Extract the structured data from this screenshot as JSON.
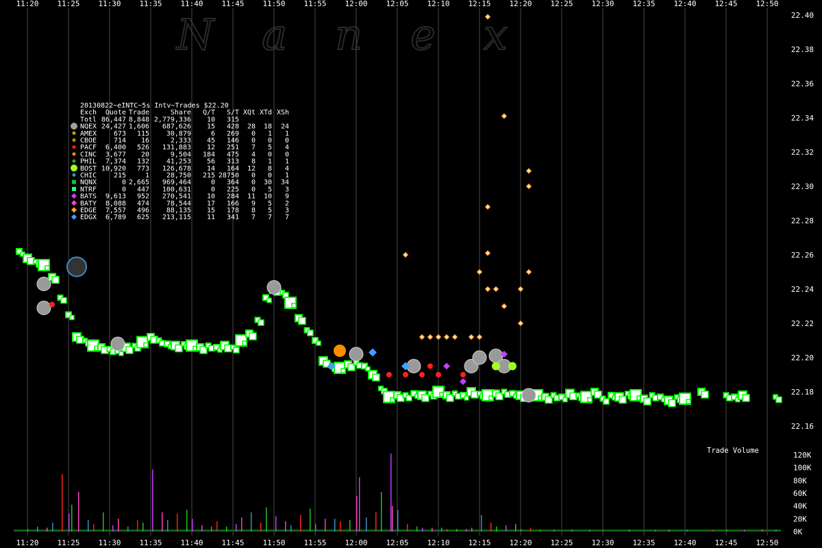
{
  "chart_data": {
    "type": "scatter",
    "watermark": "Nanex",
    "x_ticks": [
      "11:20",
      "11:25",
      "11:30",
      "11:35",
      "11:40",
      "11:45",
      "11:50",
      "11:55",
      "12:00",
      "12:05",
      "12:10",
      "12:15",
      "12:20",
      "12:25",
      "12:30",
      "12:35",
      "12:40",
      "12:45",
      "12:50"
    ],
    "y_ticks": [
      "22.40",
      "22.38",
      "22.36",
      "22.34",
      "22.32",
      "22.30",
      "22.28",
      "22.26",
      "22.24",
      "22.22",
      "22.20",
      "22.18",
      "22.16"
    ],
    "ylim": [
      22.16,
      22.4
    ],
    "volume_label": "Trade Volume",
    "volume_ticks": [
      "120K",
      "100K",
      "80K",
      "60K",
      "40K",
      "20K",
      "0K"
    ],
    "volume_ylim": [
      0,
      120000
    ],
    "table": {
      "title": "20130822~eINTC~5s Intv~Trades $22.20",
      "headers": [
        "Exch",
        "Quote",
        "Trade",
        "Share",
        "Q/T",
        "S/T",
        "XQt",
        "XTd",
        "XSh"
      ],
      "rows": [
        {
          "exch": "Totl",
          "quote": "86,447",
          "trade": "8,848",
          "share": "2,779,336",
          "qt": "10",
          "st": "315",
          "xqt": "",
          "xtd": "",
          "xsh": "",
          "color": "",
          "marker": ""
        },
        {
          "exch": "NQEX",
          "quote": "24,427",
          "trade": "1,606",
          "share": "687,626",
          "qt": "15",
          "st": "428",
          "xqt": "28",
          "xtd": "18",
          "xsh": "24",
          "color": "#a0a0a0",
          "marker": "bigcircle"
        },
        {
          "exch": "AMEX",
          "quote": "673",
          "trade": "115",
          "share": "30,879",
          "qt": "6",
          "st": "269",
          "xqt": "0",
          "xtd": "1",
          "xsh": "1",
          "color": "#c8a000",
          "marker": "circle"
        },
        {
          "exch": "CBOE",
          "quote": "714",
          "trade": "16",
          "share": "2,333",
          "qt": "45",
          "st": "146",
          "xqt": "0",
          "xtd": "0",
          "xsh": "0",
          "color": "#a0a000",
          "marker": "circle"
        },
        {
          "exch": "PACF",
          "quote": "6,400",
          "trade": "526",
          "share": "131,883",
          "qt": "12",
          "st": "251",
          "xqt": "7",
          "xtd": "5",
          "xsh": "4",
          "color": "#ff2020",
          "marker": "circle"
        },
        {
          "exch": "CINC",
          "quote": "3,677",
          "trade": "20",
          "share": "9,504",
          "qt": "184",
          "st": "475",
          "xqt": "4",
          "xtd": "0",
          "xsh": "0",
          "color": "#ff8c00",
          "marker": "circle"
        },
        {
          "exch": "PHIL",
          "quote": "7,374",
          "trade": "132",
          "share": "41,253",
          "qt": "56",
          "st": "313",
          "xqt": "8",
          "xtd": "1",
          "xsh": "1",
          "color": "#20b020",
          "marker": "circle"
        },
        {
          "exch": "BOST",
          "quote": "10,920",
          "trade": "773",
          "share": "126,678",
          "qt": "14",
          "st": "164",
          "xqt": "12",
          "xtd": "8",
          "xsh": "4",
          "color": "#a0ff20",
          "marker": "bigcircle"
        },
        {
          "exch": "CHIC",
          "quote": "215",
          "trade": "1",
          "share": "28,750",
          "qt": "215",
          "st": "28750",
          "xqt": "0",
          "xtd": "0",
          "xsh": "1",
          "color": "#3c8cc8",
          "marker": "circle"
        },
        {
          "exch": "NQNX",
          "quote": "0",
          "trade": "2,665",
          "share": "969,464",
          "qt": "0",
          "st": "364",
          "xqt": "0",
          "xtd": "30",
          "xsh": "34",
          "color": "#20c020",
          "marker": "square"
        },
        {
          "exch": "NTRF",
          "quote": "0",
          "trade": "447",
          "share": "100,631",
          "qt": "0",
          "st": "225",
          "xqt": "0",
          "xtd": "5",
          "xsh": "3",
          "color": "#20ff80",
          "marker": "square"
        },
        {
          "exch": "BATS",
          "quote": "9,613",
          "trade": "952",
          "share": "270,541",
          "qt": "10",
          "st": "284",
          "xqt": "11",
          "xtd": "10",
          "xsh": "9",
          "color": "#c040ff",
          "marker": "diamond"
        },
        {
          "exch": "BATY",
          "quote": "8,088",
          "trade": "474",
          "share": "78,544",
          "qt": "17",
          "st": "166",
          "xqt": "9",
          "xtd": "5",
          "xsh": "2",
          "color": "#ff40c0",
          "marker": "diamond"
        },
        {
          "exch": "EDGE",
          "quote": "7,557",
          "trade": "496",
          "share": "88,135",
          "qt": "15",
          "st": "178",
          "xqt": "8",
          "xtd": "5",
          "xsh": "3",
          "color": "#ffa030",
          "marker": "diamond"
        },
        {
          "exch": "EDGX",
          "quote": "6,789",
          "trade": "625",
          "share": "213,115",
          "qt": "11",
          "st": "341",
          "xqt": "7",
          "xtd": "7",
          "xsh": "7",
          "color": "#40a0ff",
          "marker": "diamond"
        }
      ]
    },
    "trade_series": [
      {
        "exchange": "NQNX",
        "color": "#00ff00",
        "points": [
          [
            "11:19",
            22.262
          ],
          [
            "11:20",
            22.258
          ],
          [
            "11:21",
            22.256
          ],
          [
            "11:22",
            22.254
          ],
          [
            "11:23",
            22.247
          ],
          [
            "11:24",
            22.235
          ],
          [
            "11:25",
            22.225
          ],
          [
            "11:26",
            22.212
          ],
          [
            "11:27",
            22.21
          ],
          [
            "11:28",
            22.207
          ],
          [
            "11:29",
            22.206
          ],
          [
            "11:30",
            22.205
          ],
          [
            "11:31",
            22.204
          ],
          [
            "11:32",
            22.206
          ],
          [
            "11:33",
            22.207
          ],
          [
            "11:34",
            22.209
          ],
          [
            "11:35",
            22.212
          ],
          [
            "11:36",
            22.21
          ],
          [
            "11:37",
            22.208
          ],
          [
            "11:38",
            22.207
          ],
          [
            "11:39",
            22.208
          ],
          [
            "11:40",
            22.207
          ],
          [
            "11:41",
            22.206
          ],
          [
            "11:42",
            22.207
          ],
          [
            "11:43",
            22.206
          ],
          [
            "11:44",
            22.207
          ],
          [
            "11:45",
            22.206
          ],
          [
            "11:46",
            22.21
          ],
          [
            "11:47",
            22.214
          ],
          [
            "11:48",
            22.222
          ],
          [
            "11:49",
            22.235
          ],
          [
            "11:50",
            22.24
          ],
          [
            "11:51",
            22.238
          ],
          [
            "11:52",
            22.232
          ],
          [
            "11:53",
            22.223
          ],
          [
            "11:54",
            22.216
          ],
          [
            "11:55",
            22.21
          ],
          [
            "11:56",
            22.198
          ],
          [
            "11:57",
            22.195
          ],
          [
            "11:58",
            22.194
          ],
          [
            "11:59",
            22.196
          ],
          [
            "12:00",
            22.197
          ],
          [
            "12:01",
            22.195
          ],
          [
            "12:02",
            22.19
          ],
          [
            "12:03",
            22.182
          ],
          [
            "12:04",
            22.177
          ],
          [
            "12:05",
            22.178
          ],
          [
            "12:06",
            22.178
          ],
          [
            "12:07",
            22.179
          ],
          [
            "12:08",
            22.178
          ],
          [
            "12:09",
            22.179
          ],
          [
            "12:10",
            22.18
          ],
          [
            "12:11",
            22.178
          ],
          [
            "12:12",
            22.179
          ],
          [
            "12:13",
            22.178
          ],
          [
            "12:14",
            22.18
          ],
          [
            "12:15",
            22.179
          ],
          [
            "12:16",
            22.178
          ],
          [
            "12:17",
            22.179
          ],
          [
            "12:18",
            22.18
          ],
          [
            "12:19",
            22.179
          ],
          [
            "12:20",
            22.178
          ],
          [
            "12:21",
            22.179
          ],
          [
            "12:22",
            22.178
          ],
          [
            "12:23",
            22.177
          ],
          [
            "12:24",
            22.178
          ],
          [
            "12:25",
            22.177
          ],
          [
            "12:26",
            22.179
          ],
          [
            "12:27",
            22.178
          ],
          [
            "12:28",
            22.177
          ],
          [
            "12:29",
            22.18
          ],
          [
            "12:30",
            22.176
          ],
          [
            "12:31",
            22.178
          ],
          [
            "12:32",
            22.177
          ],
          [
            "12:33",
            22.179
          ],
          [
            "12:34",
            22.178
          ],
          [
            "12:35",
            22.176
          ],
          [
            "12:36",
            22.178
          ],
          [
            "12:37",
            22.177
          ],
          [
            "12:38",
            22.175
          ],
          [
            "12:39",
            22.177
          ],
          [
            "12:40",
            22.176
          ],
          [
            "12:42",
            22.18
          ],
          [
            "12:45",
            22.178
          ],
          [
            "12:46",
            22.177
          ],
          [
            "12:47",
            22.178
          ],
          [
            "12:51",
            22.177
          ]
        ]
      },
      {
        "exchange": "NQEX",
        "color": "#a0a0a0",
        "points": [
          [
            "11:22",
            22.243
          ],
          [
            "11:22",
            22.229
          ],
          [
            "11:31",
            22.208
          ],
          [
            "11:50",
            22.241
          ],
          [
            "12:00",
            22.202
          ],
          [
            "12:07",
            22.195
          ],
          [
            "12:14",
            22.195
          ],
          [
            "12:15",
            22.2
          ],
          [
            "12:17",
            22.201
          ],
          [
            "12:18",
            22.195
          ],
          [
            "12:21",
            22.178
          ]
        ]
      },
      {
        "exchange": "EDGE",
        "color": "#ffa030",
        "points": [
          [
            "12:08",
            22.212
          ],
          [
            "12:09",
            22.212
          ],
          [
            "12:10",
            22.212
          ],
          [
            "12:11",
            22.212
          ],
          [
            "12:12",
            22.212
          ],
          [
            "12:14",
            22.212
          ],
          [
            "12:15",
            22.212
          ],
          [
            "12:06",
            22.26
          ],
          [
            "12:15",
            22.25
          ],
          [
            "12:16",
            22.24
          ],
          [
            "12:17",
            22.24
          ],
          [
            "12:20",
            22.24
          ],
          [
            "12:18",
            22.23
          ],
          [
            "12:20",
            22.22
          ],
          [
            "12:16",
            22.261
          ],
          [
            "12:18",
            22.341
          ],
          [
            "12:16",
            22.288
          ],
          [
            "12:21",
            22.309
          ],
          [
            "12:21",
            22.3
          ],
          [
            "12:21",
            22.25
          ],
          [
            "12:16",
            22.399
          ]
        ]
      },
      {
        "exchange": "BATS",
        "color": "#c040ff",
        "points": [
          [
            "12:18",
            22.202
          ],
          [
            "12:11",
            22.195
          ],
          [
            "12:13",
            22.186
          ]
        ]
      },
      {
        "exchange": "EDGX",
        "color": "#40a0ff",
        "points": [
          [
            "12:06",
            22.195
          ],
          [
            "12:02",
            22.203
          ],
          [
            "11:57",
            22.195
          ]
        ]
      },
      {
        "exchange": "PACF",
        "color": "#ff2020",
        "points": [
          [
            "12:09",
            22.195
          ],
          [
            "11:23",
            22.231
          ],
          [
            "12:04",
            22.19
          ],
          [
            "12:06",
            22.19
          ],
          [
            "12:08",
            22.19
          ],
          [
            "12:10",
            22.19
          ],
          [
            "12:13",
            22.19
          ]
        ]
      },
      {
        "exchange": "CINC",
        "color": "#ff8c00",
        "points": [
          [
            "11:58",
            22.204
          ]
        ]
      },
      {
        "exchange": "BOST",
        "color": "#a0ff20",
        "points": [
          [
            "12:19",
            22.195
          ],
          [
            "12:17",
            22.195
          ]
        ]
      },
      {
        "exchange": "CHIC",
        "color": "#3c8cc8",
        "points": [
          [
            "11:26",
            22.253
          ]
        ]
      }
    ],
    "volume_bars": [
      [
        "11:20",
        4000
      ],
      [
        "11:21",
        8000
      ],
      [
        "11:22",
        6000
      ],
      [
        "11:23",
        14000
      ],
      [
        "11:24",
        90000
      ],
      [
        "11:25",
        42000
      ],
      [
        "11:25",
        28000
      ],
      [
        "11:26",
        62000
      ],
      [
        "11:27",
        18000
      ],
      [
        "11:28",
        12000
      ],
      [
        "11:29",
        30000
      ],
      [
        "11:30",
        10000
      ],
      [
        "11:31",
        20000
      ],
      [
        "11:32",
        8000
      ],
      [
        "11:33",
        18000
      ],
      [
        "11:34",
        14000
      ],
      [
        "11:35",
        97000
      ],
      [
        "11:36",
        30000
      ],
      [
        "11:37",
        18000
      ],
      [
        "11:38",
        28000
      ],
      [
        "11:39",
        34000
      ],
      [
        "11:40",
        20000
      ],
      [
        "11:41",
        10000
      ],
      [
        "11:42",
        8000
      ],
      [
        "11:43",
        16000
      ],
      [
        "11:44",
        8000
      ],
      [
        "11:45",
        12000
      ],
      [
        "11:46",
        22000
      ],
      [
        "11:47",
        30000
      ],
      [
        "11:48",
        14000
      ],
      [
        "11:49",
        38000
      ],
      [
        "11:50",
        24000
      ],
      [
        "11:51",
        16000
      ],
      [
        "11:52",
        10000
      ],
      [
        "11:53",
        26000
      ],
      [
        "11:54",
        36000
      ],
      [
        "11:55",
        12000
      ],
      [
        "11:56",
        20000
      ],
      [
        "11:57",
        20000
      ],
      [
        "11:58",
        16000
      ],
      [
        "11:59",
        18000
      ],
      [
        "12:00",
        85000
      ],
      [
        "12:00",
        56000
      ],
      [
        "12:01",
        22000
      ],
      [
        "12:02",
        30000
      ],
      [
        "12:03",
        62000
      ],
      [
        "12:04",
        122000
      ],
      [
        "12:04",
        40000
      ],
      [
        "12:05",
        34000
      ],
      [
        "12:06",
        12000
      ],
      [
        "12:07",
        8000
      ],
      [
        "12:08",
        6000
      ],
      [
        "12:09",
        6000
      ],
      [
        "12:10",
        6000
      ],
      [
        "12:11",
        4000
      ],
      [
        "12:12",
        4000
      ],
      [
        "12:13",
        4000
      ],
      [
        "12:14",
        6000
      ],
      [
        "12:15",
        26000
      ],
      [
        "12:16",
        14000
      ],
      [
        "12:17",
        8000
      ],
      [
        "12:18",
        10000
      ],
      [
        "12:19",
        12000
      ],
      [
        "12:20",
        4000
      ],
      [
        "12:21",
        6000
      ],
      [
        "12:22",
        3000
      ],
      [
        "12:24",
        3000
      ],
      [
        "12:26",
        3000
      ],
      [
        "12:28",
        3000
      ],
      [
        "12:30",
        3000
      ],
      [
        "12:33",
        3000
      ],
      [
        "12:36",
        3000
      ],
      [
        "12:38",
        3000
      ],
      [
        "12:40",
        3000
      ],
      [
        "12:43",
        3000
      ],
      [
        "12:45",
        3000
      ],
      [
        "12:47",
        3000
      ],
      [
        "12:49",
        3000
      ],
      [
        "12:51",
        3000
      ]
    ]
  }
}
